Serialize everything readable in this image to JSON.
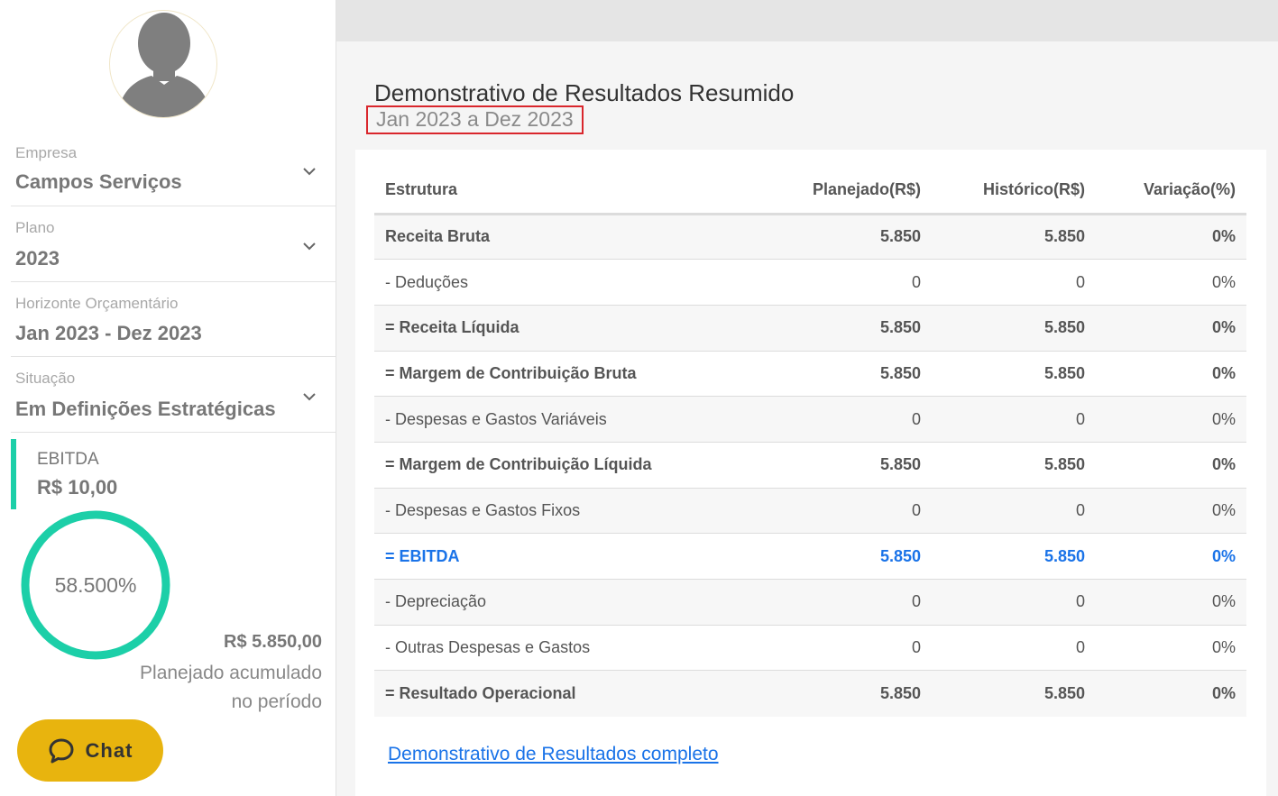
{
  "sidebar": {
    "fields": [
      {
        "label": "Empresa",
        "value": "Campos Serviços",
        "has_dropdown": true
      },
      {
        "label": "Plano",
        "value": "2023",
        "has_dropdown": true
      },
      {
        "label": "Horizonte Orçamentário",
        "value": "Jan 2023 - Dez 2023",
        "has_dropdown": false
      },
      {
        "label": "Situação",
        "value": "Em Definições Estratégicas",
        "has_dropdown": true
      }
    ],
    "ebitda": {
      "label": "EBITDA",
      "value": "R$ 10,00",
      "accent_color": "#1ccfa8"
    },
    "progress": {
      "label": "58.500%",
      "value_percent": 58.5
    },
    "accumulated": {
      "value": "R$ 5.850,00",
      "label": "Planejado acumulado no período"
    },
    "chat": {
      "label": "Chat",
      "color": "#e8b40e",
      "icon": "chat-bubble-icon"
    }
  },
  "report": {
    "title": "Demonstrativo de Resultados Resumido",
    "period": "Jan 2023 a Dez 2023",
    "columns": [
      "Estrutura",
      "Planejado(R$)",
      "Histórico(R$)",
      "Variação(%)"
    ],
    "rows": [
      {
        "label": "Receita Bruta",
        "planned": "5.850",
        "historical": "5.850",
        "variation": "0%",
        "style": "bold"
      },
      {
        "label": "- Deduções",
        "planned": "0",
        "historical": "0",
        "variation": "0%",
        "style": "normal"
      },
      {
        "label": "= Receita Líquida",
        "planned": "5.850",
        "historical": "5.850",
        "variation": "0%",
        "style": "bold"
      },
      {
        "label": "= Margem de Contribuição Bruta",
        "planned": "5.850",
        "historical": "5.850",
        "variation": "0%",
        "style": "bold"
      },
      {
        "label": "- Despesas e Gastos Variáveis",
        "planned": "0",
        "historical": "0",
        "variation": "0%",
        "style": "normal"
      },
      {
        "label": "= Margem de Contribuição Líquida",
        "planned": "5.850",
        "historical": "5.850",
        "variation": "0%",
        "style": "bold"
      },
      {
        "label": "- Despesas e Gastos Fixos",
        "planned": "0",
        "historical": "0",
        "variation": "0%",
        "style": "normal"
      },
      {
        "label": "= EBITDA",
        "planned": "5.850",
        "historical": "5.850",
        "variation": "0%",
        "style": "highlight"
      },
      {
        "label": "- Depreciação",
        "planned": "0",
        "historical": "0",
        "variation": "0%",
        "style": "normal"
      },
      {
        "label": "- Outras Despesas e Gastos",
        "planned": "0",
        "historical": "0",
        "variation": "0%",
        "style": "normal"
      },
      {
        "label": "= Resultado Operacional",
        "planned": "5.850",
        "historical": "5.850",
        "variation": "0%",
        "style": "bold"
      }
    ],
    "highlight_color": "#1a73e8",
    "full_report_link": "Demonstrativo de Resultados completo"
  }
}
